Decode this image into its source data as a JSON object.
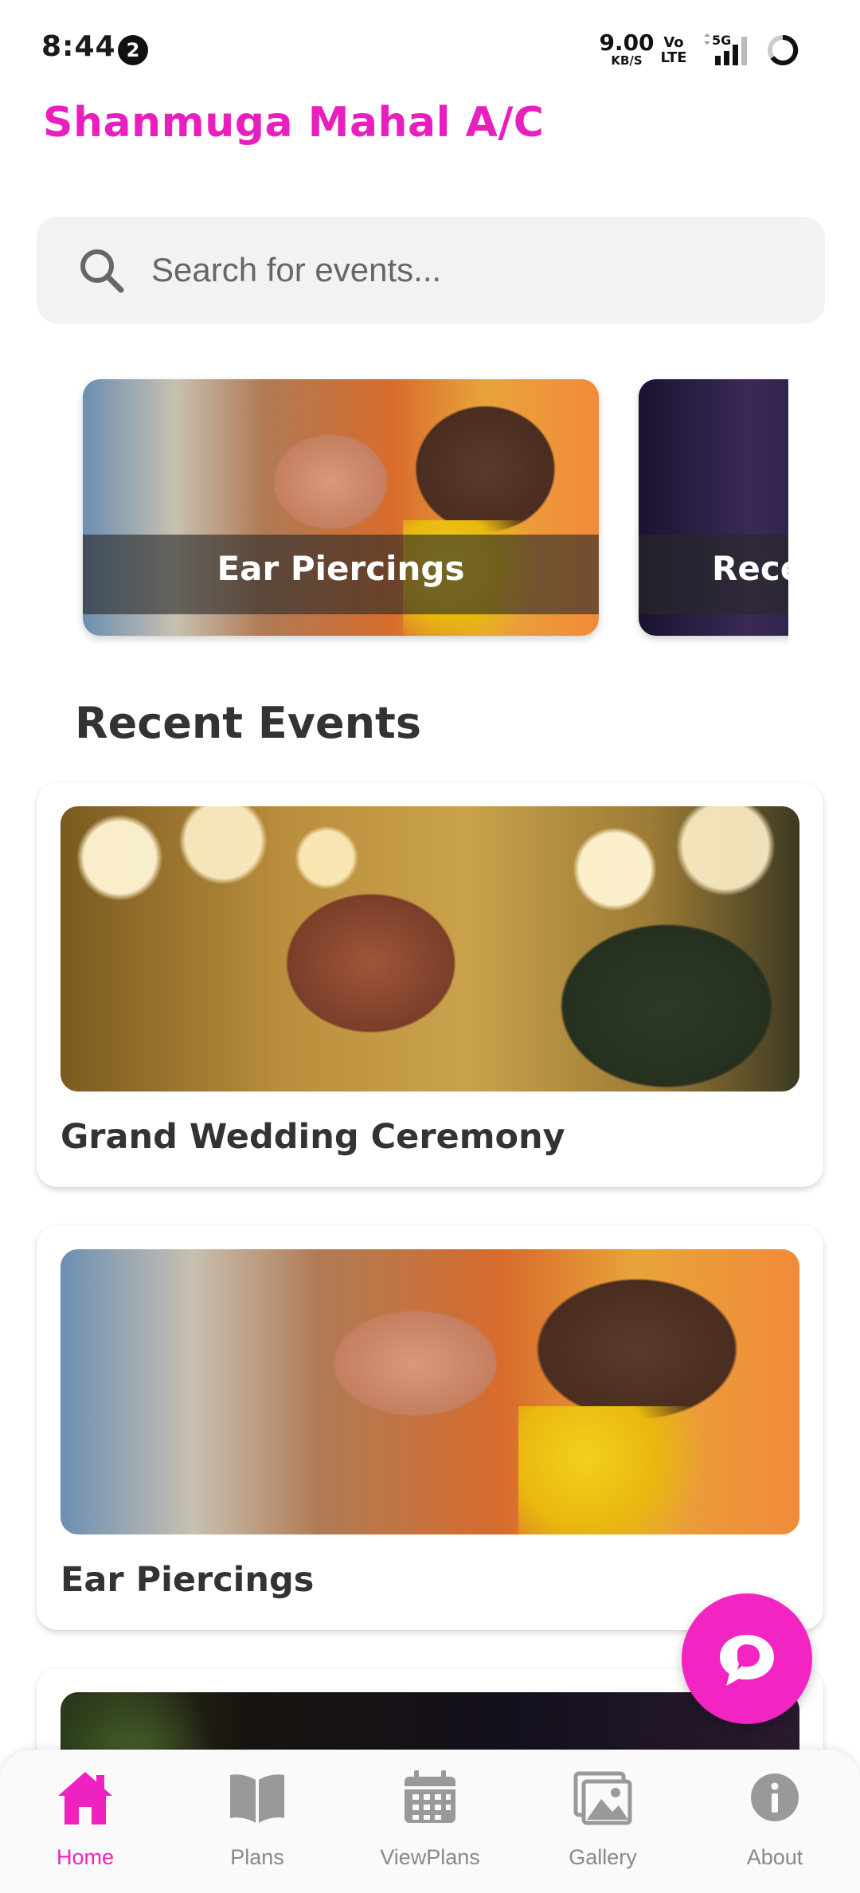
{
  "status_bar": {
    "time": "8:44",
    "notification_count": "2",
    "net_speed_value": "9.00",
    "net_speed_unit": "KB/S",
    "volte_top": "Vo",
    "volte_bottom": "LTE",
    "network_type": "5G"
  },
  "header": {
    "title": "Shanmuga Mahal A/C"
  },
  "search": {
    "placeholder": "Search for events..."
  },
  "carousel": {
    "items": [
      {
        "label": "Ear Piercings"
      },
      {
        "label": "Rece"
      }
    ]
  },
  "recent_events": {
    "title": "Recent Events",
    "items": [
      {
        "name": "Grand Wedding Ceremony"
      },
      {
        "name": "Ear Piercings"
      },
      {
        "name": ""
      }
    ]
  },
  "bottom_nav": {
    "items": [
      {
        "label": "Home",
        "icon": "home-icon",
        "active": true
      },
      {
        "label": "Plans",
        "icon": "book-icon",
        "active": false
      },
      {
        "label": "ViewPlans",
        "icon": "calendar-icon",
        "active": false
      },
      {
        "label": "Gallery",
        "icon": "gallery-icon",
        "active": false
      },
      {
        "label": "About",
        "icon": "info-icon",
        "active": false
      }
    ]
  },
  "colors": {
    "brand": "#e91ebf",
    "fab": "#f224c4",
    "inactive_nav": "#888888",
    "search_bg": "#f2f2f2"
  }
}
